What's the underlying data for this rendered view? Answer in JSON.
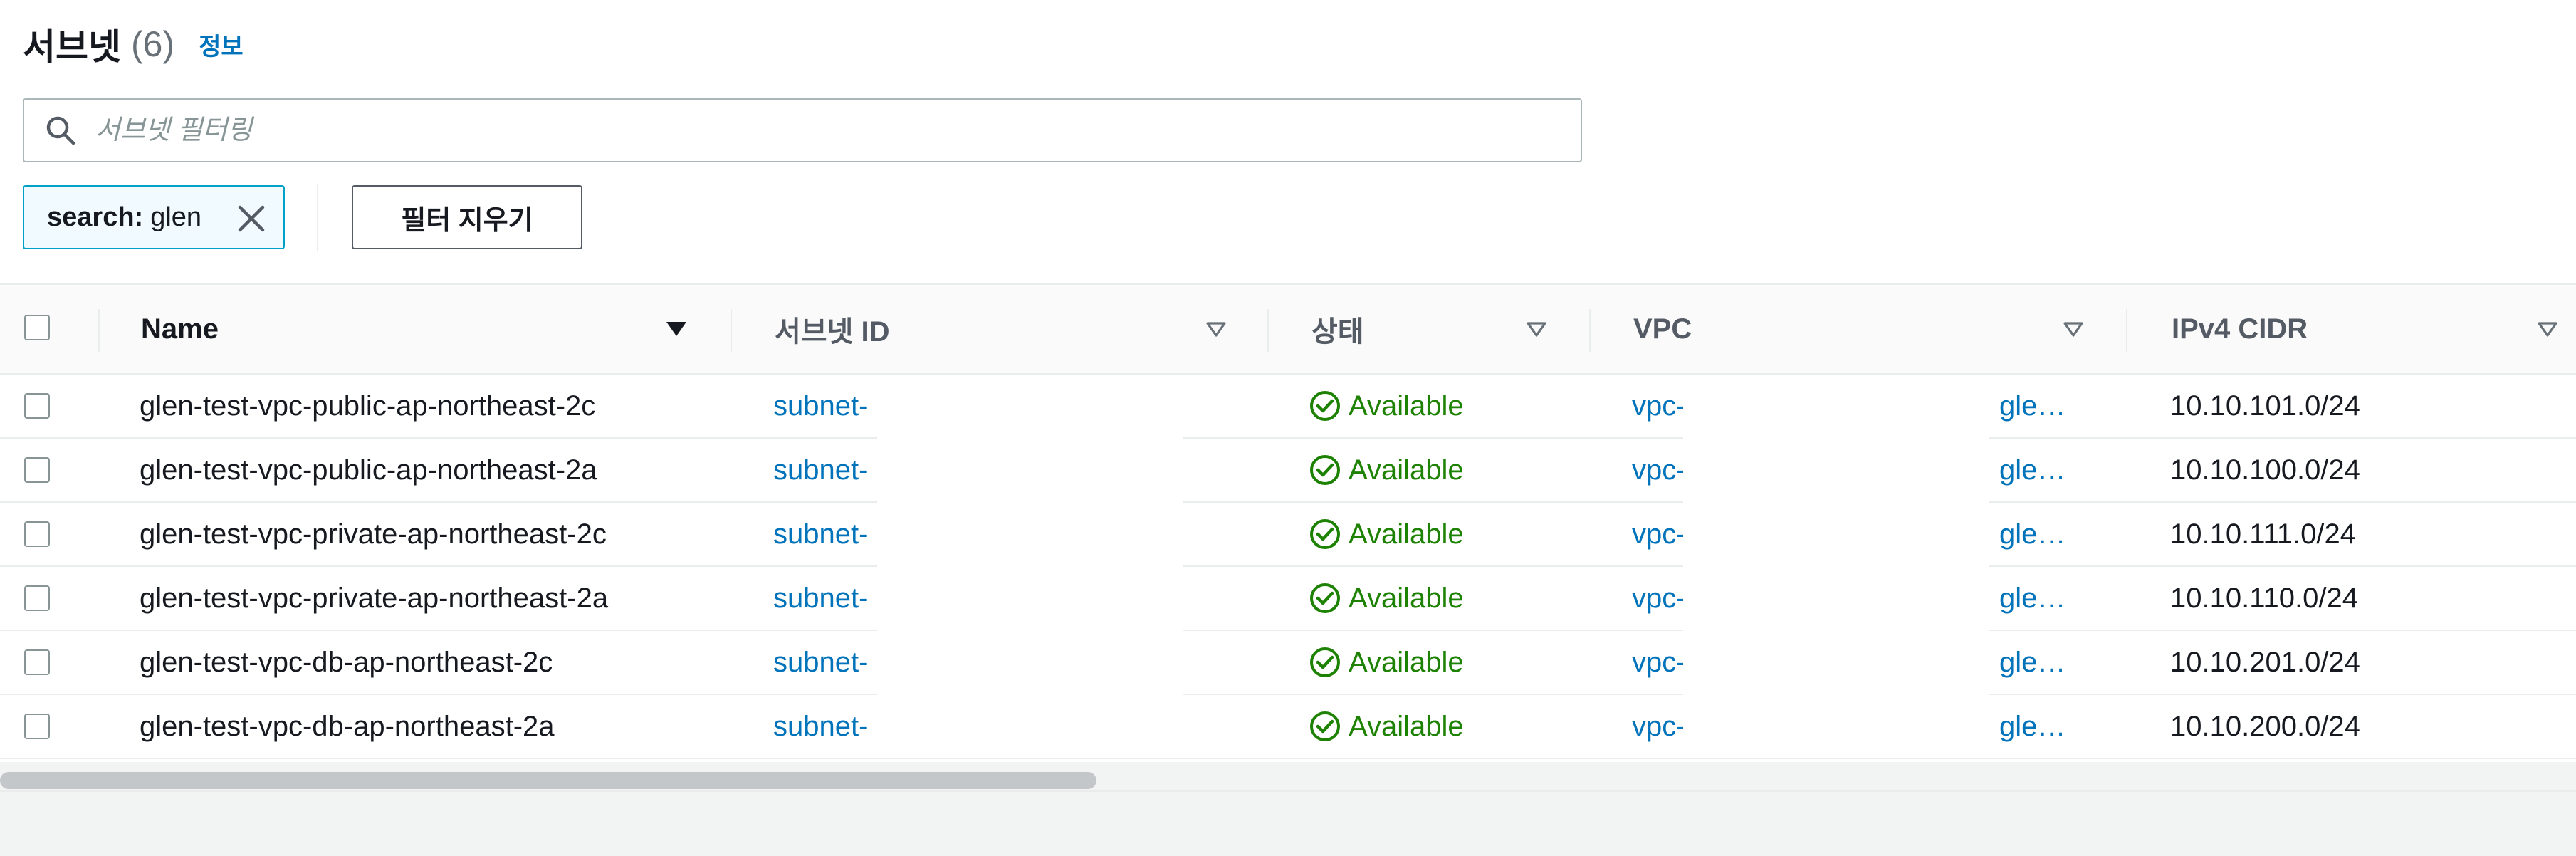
{
  "header": {
    "title": "서브넷",
    "count": "(6)",
    "info_link": "정보"
  },
  "search": {
    "placeholder": "서브넷 필터링"
  },
  "filter_token": {
    "key": "search:",
    "value": "glen"
  },
  "clear_filters_label": "필터 지우기",
  "table": {
    "columns": [
      "Name",
      "서브넷 ID",
      "상태",
      "VPC",
      "IPv4 CIDR"
    ],
    "rows": [
      {
        "name": "glen-test-vpc-public-ap-northeast-2c",
        "subnet_id": "subnet-",
        "state": "Available",
        "vpc": "vpc-",
        "vpc_name": "gle…",
        "cidr": "10.10.101.0/24"
      },
      {
        "name": "glen-test-vpc-public-ap-northeast-2a",
        "subnet_id": "subnet-",
        "state": "Available",
        "vpc": "vpc-",
        "vpc_name": "gle…",
        "cidr": "10.10.100.0/24"
      },
      {
        "name": "glen-test-vpc-private-ap-northeast-2c",
        "subnet_id": "subnet-",
        "state": "Available",
        "vpc": "vpc-",
        "vpc_name": "gle…",
        "cidr": "10.10.111.0/24"
      },
      {
        "name": "glen-test-vpc-private-ap-northeast-2a",
        "subnet_id": "subnet-",
        "state": "Available",
        "vpc": "vpc-",
        "vpc_name": "gle…",
        "cidr": "10.10.110.0/24"
      },
      {
        "name": "glen-test-vpc-db-ap-northeast-2c",
        "subnet_id": "subnet-",
        "state": "Available",
        "vpc": "vpc-",
        "vpc_name": "gle…",
        "cidr": "10.10.201.0/24"
      },
      {
        "name": "glen-test-vpc-db-ap-northeast-2a",
        "subnet_id": "subnet-",
        "state": "Available",
        "vpc": "vpc-",
        "vpc_name": "gle…",
        "cidr": "10.10.200.0/24"
      }
    ]
  },
  "colors": {
    "link": "#0073bb",
    "available": "#1d8102",
    "token_border": "#00a1c9"
  },
  "icons": {
    "search": "search-icon",
    "remove_token": "close-icon",
    "sort_active": "caret-down-filled-icon",
    "sort_inactive": "caret-down-outline-icon",
    "status": "check-circle-icon"
  }
}
